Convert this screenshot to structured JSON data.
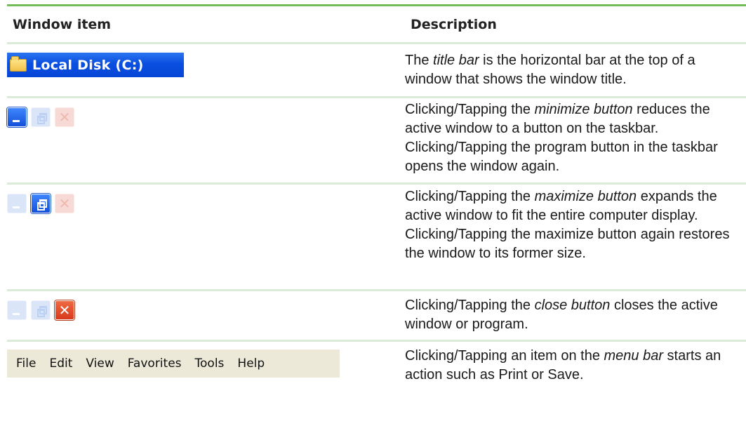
{
  "header": {
    "col1": "Window item",
    "col2": "Description"
  },
  "rows": [
    {
      "sample": {
        "title": "Local Disk (C:)",
        "icon": "folder-icon"
      },
      "desc": {
        "pre": "The ",
        "term": "title bar",
        "post": " is the horizontal bar at the top of a window that shows the window title."
      }
    },
    {
      "sample": {
        "highlight": "minimize"
      },
      "desc": {
        "pre": "Clicking/Tapping the ",
        "term": "minimize button",
        "post": " reduces the active window to a button on the taskbar. Clicking/Tapping the program button in the taskbar opens the window again."
      }
    },
    {
      "sample": {
        "highlight": "maximize"
      },
      "desc": {
        "pre": "Clicking/Tapping the ",
        "term": "maximize button",
        "post": " expands the active window to fit the entire computer display. Clicking/Tapping the maximize button again restores the window to its former size."
      }
    },
    {
      "sample": {
        "highlight": "close"
      },
      "desc": {
        "pre": "Clicking/Tapping the ",
        "term": "close button",
        "post": " closes the active window or program."
      }
    },
    {
      "sample": {
        "menu_items": [
          "File",
          "Edit",
          "View",
          "Favorites",
          "Tools",
          "Help"
        ]
      },
      "desc": {
        "pre": "Clicking/Tapping an item on the ",
        "term": "menu bar",
        "post": " starts an action such as Print or Save."
      }
    }
  ],
  "colors": {
    "accent_rule": "#72bd5a",
    "row_rule": "#dcebd6",
    "titlebar_blue": "#0a4fe0",
    "close_red": "#d8391b"
  }
}
